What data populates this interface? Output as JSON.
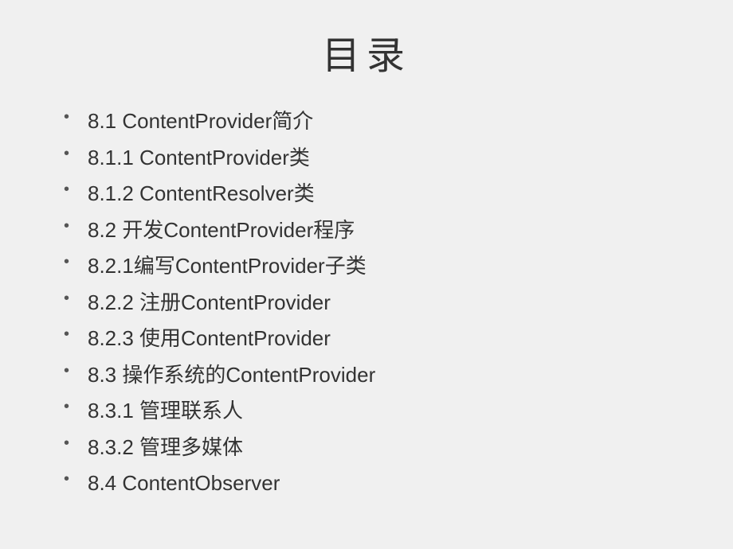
{
  "title": "目录",
  "items": [
    {
      "text": "8.1 ContentProvider简介"
    },
    {
      "text": "8.1.1 ContentProvider类"
    },
    {
      "text": "8.1.2 ContentResolver类"
    },
    {
      "text": "8.2 开发ContentProvider程序"
    },
    {
      "text": "8.2.1编写ContentProvider子类"
    },
    {
      "text": "8.2.2 注册ContentProvider"
    },
    {
      "text": "8.2.3 使用ContentProvider"
    },
    {
      "text": "8.3 操作系统的ContentProvider"
    },
    {
      "text": "8.3.1 管理联系人"
    },
    {
      "text": "8.3.2 管理多媒体"
    },
    {
      "text": "8.4 ContentObserver"
    }
  ]
}
